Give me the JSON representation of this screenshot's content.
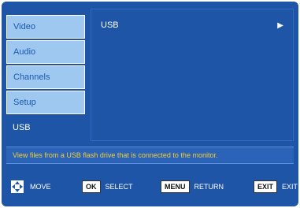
{
  "sidebar": {
    "items": [
      {
        "label": "Video"
      },
      {
        "label": "Audio"
      },
      {
        "label": "Channels"
      },
      {
        "label": "Setup"
      },
      {
        "label": "USB"
      }
    ]
  },
  "content": {
    "rows": [
      {
        "label": "USB",
        "arrow": "▶"
      }
    ]
  },
  "description": "View files from a USB flash drive that is connected to the monitor.",
  "keys": [
    {
      "icon": "dpad-icon",
      "key": "",
      "label": "MOVE"
    },
    {
      "key": "OK",
      "label": "SELECT"
    },
    {
      "key": "MENU",
      "label": "RETURN"
    },
    {
      "key": "EXIT",
      "label": "EXIT"
    }
  ],
  "colors": {
    "panel": "#1f55a6",
    "menu_light": "#9ec8f0",
    "description_text": "#f2cf36"
  }
}
